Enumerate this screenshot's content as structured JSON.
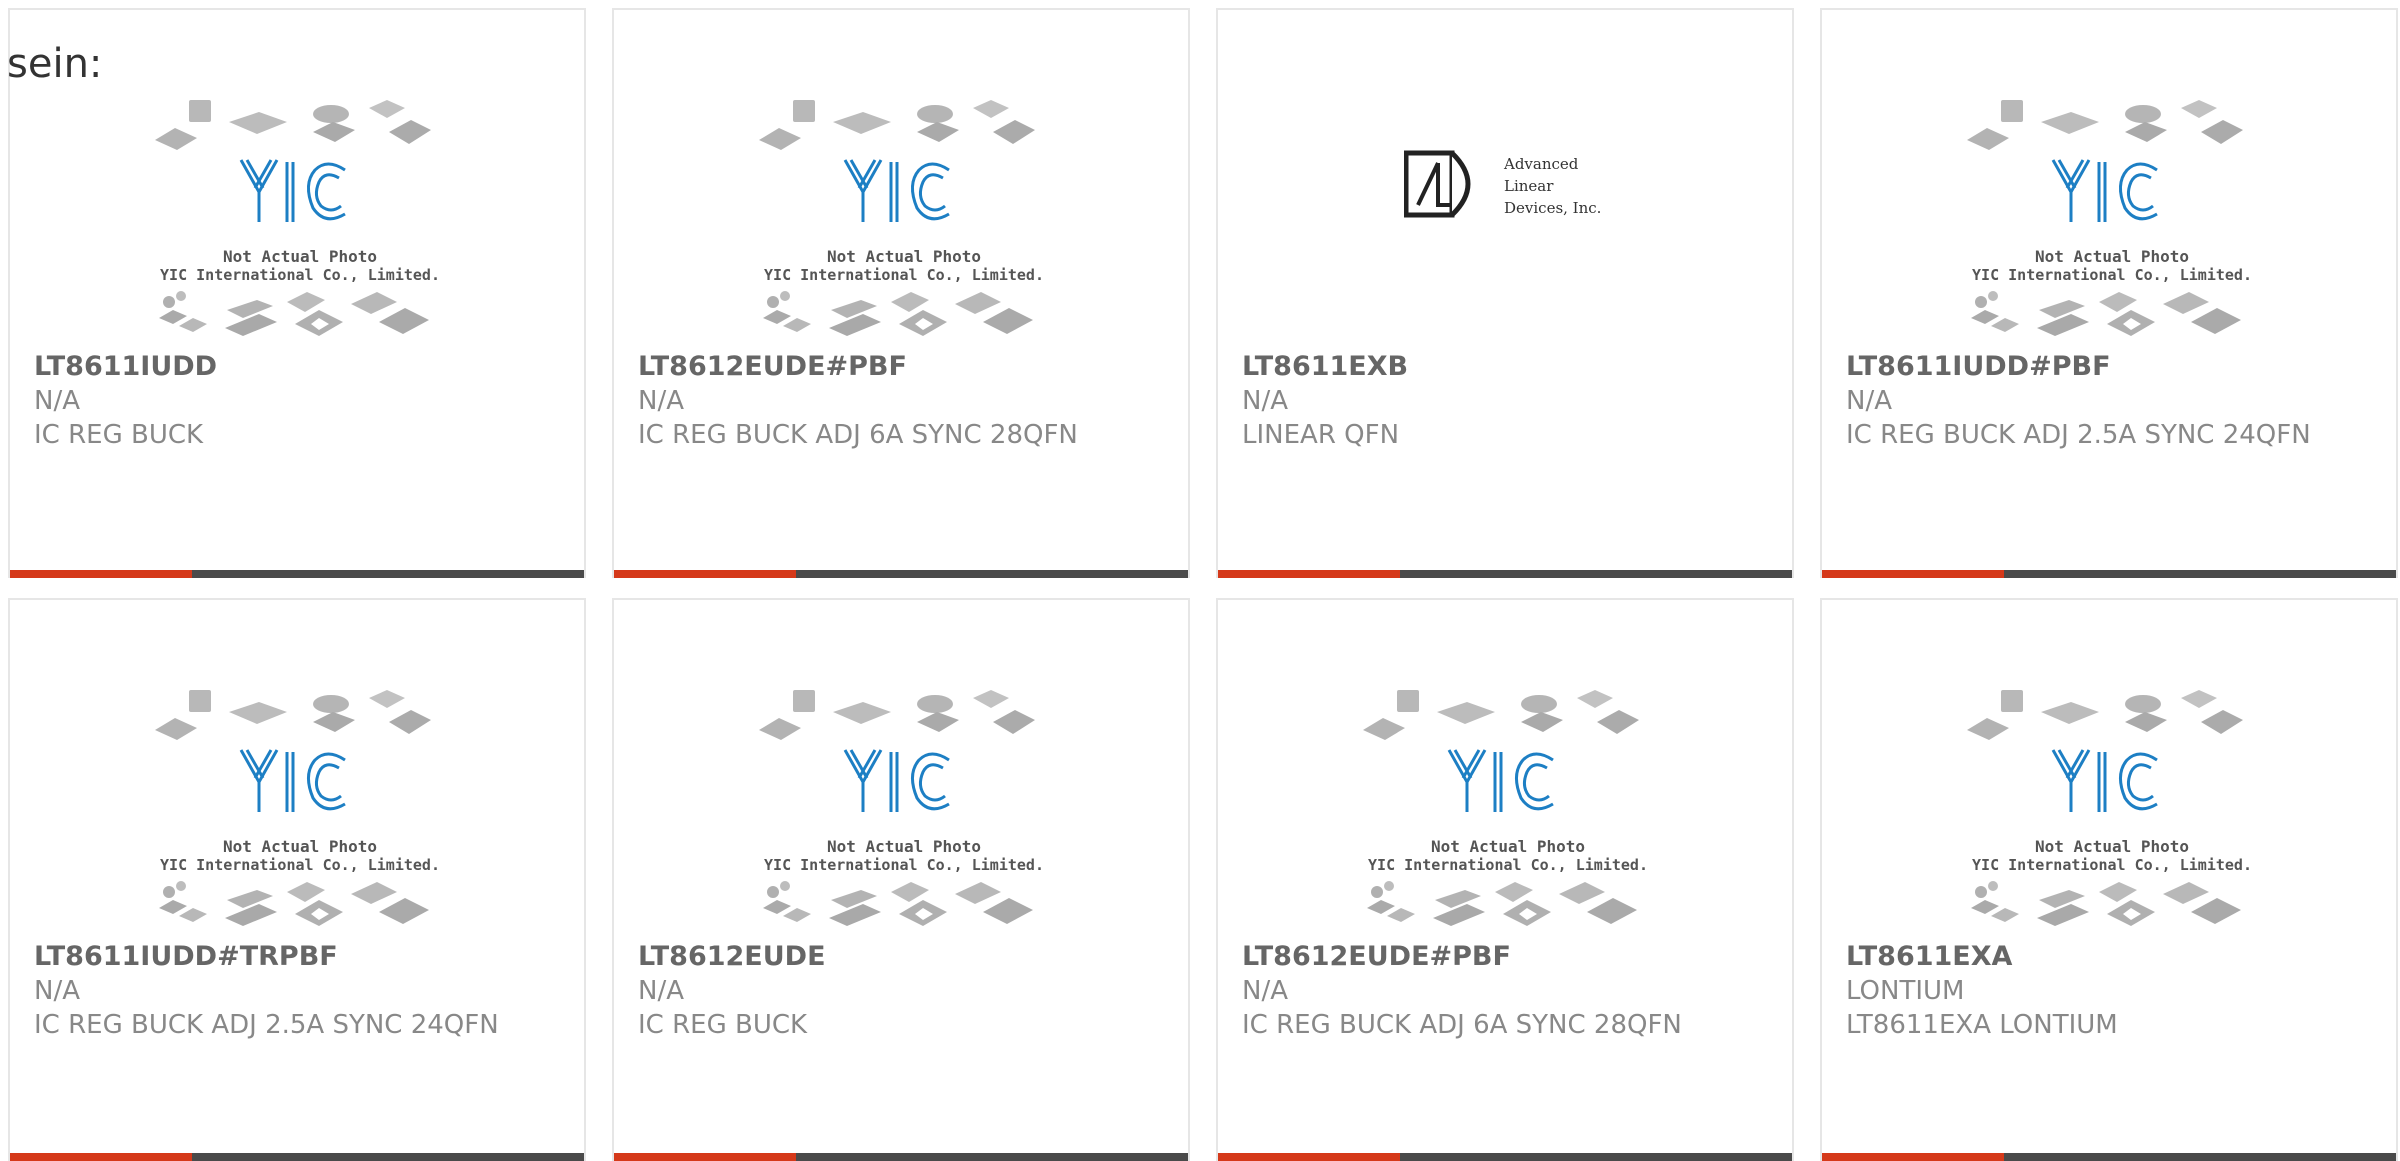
{
  "intro_text": "sein:",
  "placeholder_image": {
    "caption_line1": "Not Actual Photo",
    "caption_line2": "YIC International Co., Limited.",
    "logo_text": "YIC"
  },
  "ald_logo": {
    "line1": "Advanced",
    "line2": "Linear",
    "line3": "Devices, Inc."
  },
  "colors": {
    "accent": "#d5391a",
    "bar": "#4a4a4a",
    "logo_blue": "#1d7fc4",
    "border": "#e6e6e6"
  },
  "products": [
    {
      "part_number": "LT8611IUDD",
      "manufacturer": "N/A",
      "description": "IC REG BUCK",
      "image": "yic-placeholder"
    },
    {
      "part_number": "LT8612EUDE#PBF",
      "manufacturer": "N/A",
      "description": "IC REG BUCK ADJ 6A SYNC 28QFN",
      "image": "yic-placeholder"
    },
    {
      "part_number": "LT8611EXB",
      "manufacturer": "N/A",
      "description": "LINEAR QFN",
      "image": "ald-logo"
    },
    {
      "part_number": "LT8611IUDD#PBF",
      "manufacturer": "N/A",
      "description": "IC REG BUCK ADJ 2.5A SYNC 24QFN",
      "image": "yic-placeholder"
    },
    {
      "part_number": "LT8611IUDD#TRPBF",
      "manufacturer": "N/A",
      "description": "IC REG BUCK ADJ 2.5A SYNC 24QFN",
      "image": "yic-placeholder"
    },
    {
      "part_number": "LT8612EUDE",
      "manufacturer": "N/A",
      "description": "IC REG BUCK",
      "image": "yic-placeholder"
    },
    {
      "part_number": "LT8612EUDE#PBF",
      "manufacturer": "N/A",
      "description": "IC REG BUCK ADJ 6A SYNC 28QFN",
      "image": "yic-placeholder"
    },
    {
      "part_number": "LT8611EXA",
      "manufacturer": "LONTIUM",
      "description": "LT8611EXA LONTIUM",
      "image": "yic-placeholder"
    }
  ]
}
